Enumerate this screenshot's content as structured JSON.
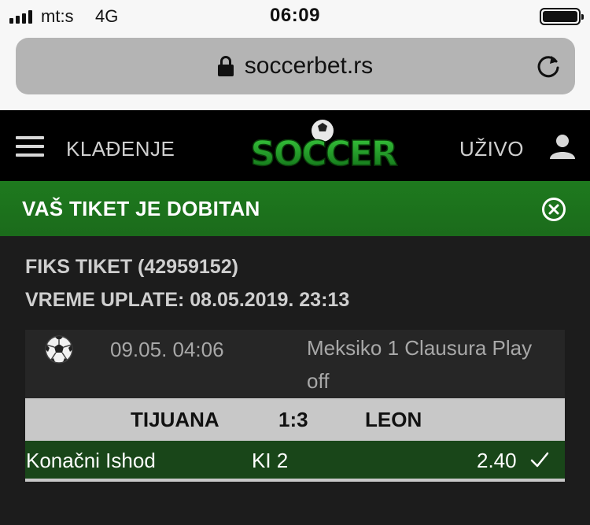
{
  "status_bar": {
    "carrier": "mt:s",
    "network": "4G",
    "time": "06:09"
  },
  "browser": {
    "url": "soccerbet.rs"
  },
  "header": {
    "nav_betting": "KLAĐENJE",
    "logo_text": "SOCCER",
    "nav_live": "UŽIVO"
  },
  "notice": {
    "text": "VAŠ TIKET JE DOBITAN"
  },
  "ticket": {
    "title": "FIKS TIKET (42959152)",
    "payment_time": "VREME UPLATE: 08.05.2019. 23:13",
    "match": {
      "date": "09.05. 04:06",
      "league": "Meksiko 1 Clausura Play off",
      "home_team": "TIJUANA",
      "score": "1:3",
      "away_team": "LEON"
    },
    "bet": {
      "market": "Konačni Ishod",
      "pick": "KI 2",
      "odd": "2.40"
    }
  },
  "colors": {
    "brand_green": "#1e7a1e",
    "bet_row_green": "#194619",
    "background": "#1c1c1c"
  }
}
